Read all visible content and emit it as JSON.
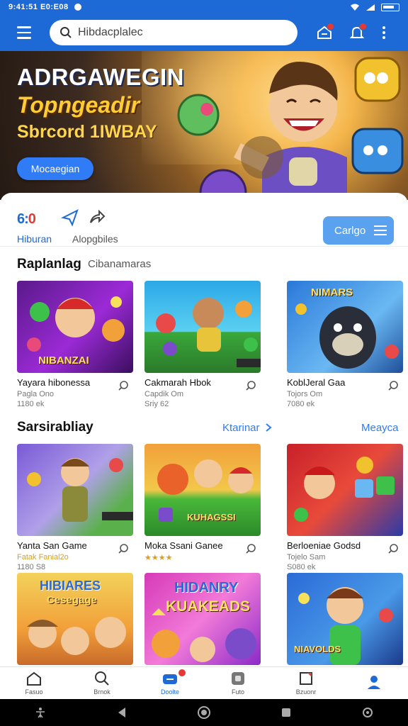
{
  "statusbar": {
    "time": "9:41:51 E0:E08"
  },
  "appbar": {
    "search_placeholder": "Hibdacplalec"
  },
  "hero": {
    "title": "ADRGAWEGIN",
    "subtitle": "Topngeadir",
    "tagline": "Sbrcord 1IWBAY",
    "button_label": "Mocaegian"
  },
  "categories": {
    "logo_left": "6:",
    "logo_right": "0",
    "tab_active": "Hiburan",
    "tab_inactive": "Alopgbiles",
    "button_label": "Carlgo"
  },
  "section1": {
    "title": "Raplanlag",
    "subtitle": "Cibanamaras",
    "cards": [
      {
        "title": "Yayara hibonessa",
        "meta1": "Pagla Ono",
        "meta2": "1180 ek",
        "banner": "NIBANZAI"
      },
      {
        "title": "Cakmarah Hbok",
        "meta1": "Capdik Om",
        "meta2": "Sriy 62",
        "banner": ""
      },
      {
        "title": "KoblJeral Gaa",
        "meta1": "Tojors Om",
        "meta2": "7080 ek",
        "banner": "NIMARS"
      }
    ]
  },
  "section2": {
    "title": "Sarsirabliay",
    "link1": "Ktarinar",
    "link2": "Meayca",
    "cards": [
      {
        "title": "Yanta San Game",
        "meta1": "Fatak Fanial2o",
        "meta2": "1180 S8",
        "banner": ""
      },
      {
        "title": "Moka Ssani Ganee",
        "meta1": "★★★★",
        "meta2": "",
        "banner": "KUHAGSSI"
      },
      {
        "title": "Berloeniae Godsd",
        "meta1": "Tojelo Sam",
        "meta2": "S080 ek",
        "banner": ""
      }
    ]
  },
  "section3": {
    "cards": [
      {
        "banner1": "HIBIARES",
        "banner2": "Cesegage"
      },
      {
        "banner1": "HIDANRY",
        "banner2": "KUAKEADS"
      },
      {
        "banner1": "NIAVOLDS"
      }
    ]
  },
  "bottomnav": {
    "items": [
      {
        "label": "Fasuo"
      },
      {
        "label": "Brnok"
      },
      {
        "label": "Doolte"
      },
      {
        "label": "Futo"
      },
      {
        "label": "Bzuonr"
      },
      {
        "label": ""
      }
    ]
  },
  "colors": {
    "primary": "#1d6ad6",
    "accent": "#2f7cf6",
    "badge": "#e53935"
  }
}
